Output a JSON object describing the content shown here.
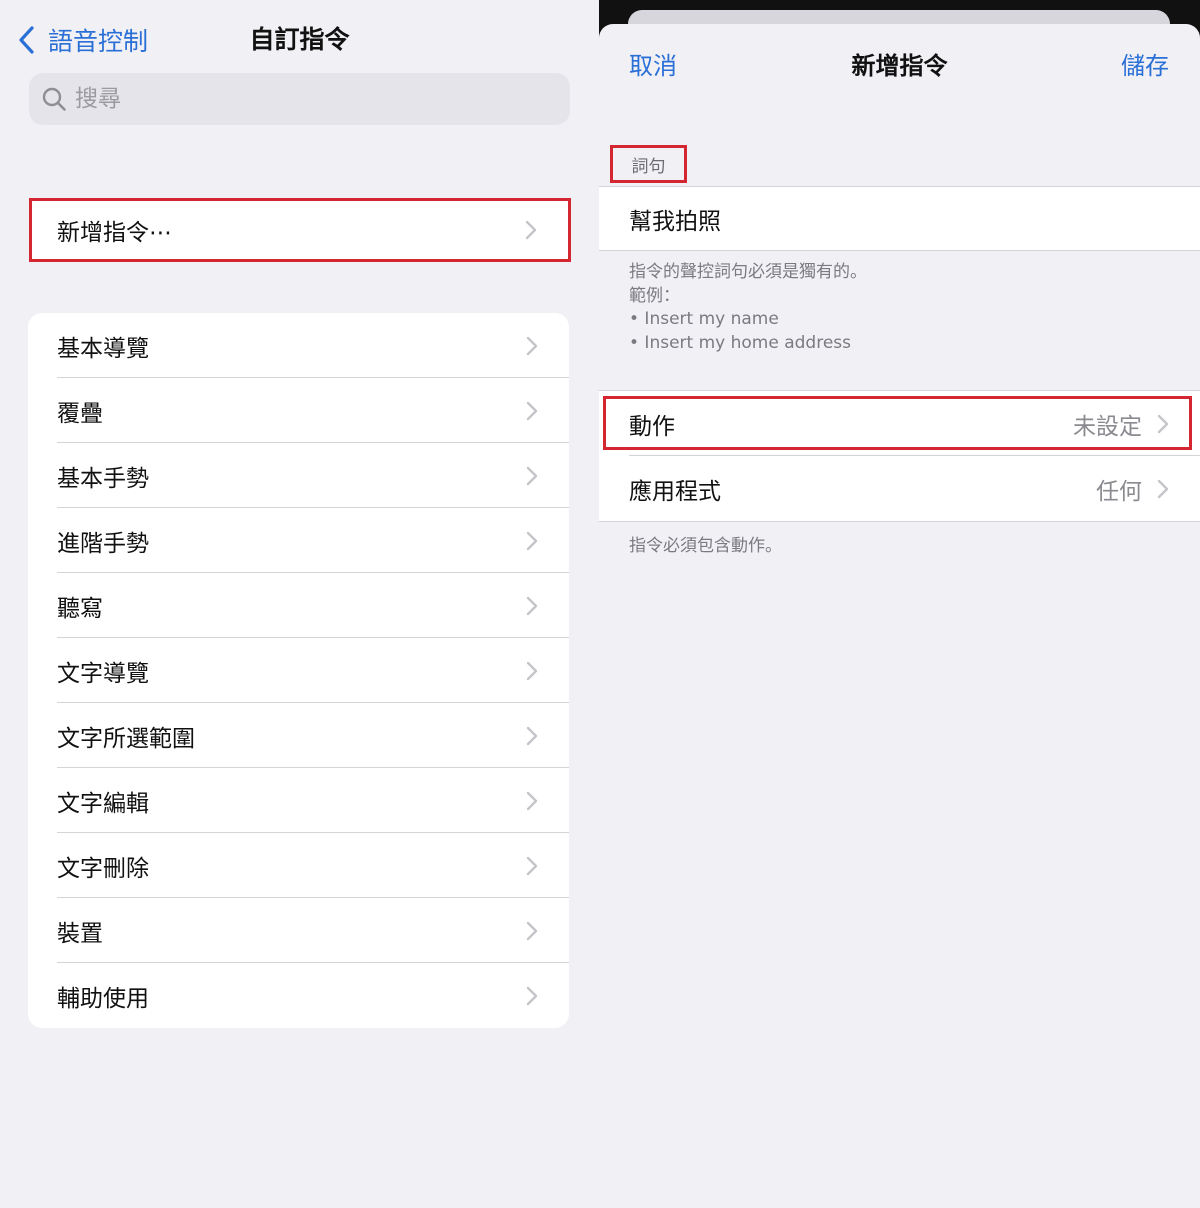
{
  "left": {
    "back_label": "語音控制",
    "title": "自訂指令",
    "search_placeholder": "搜尋",
    "add_label": "新增指令⋯",
    "items": [
      {
        "label": "基本導覽"
      },
      {
        "label": "覆疊"
      },
      {
        "label": "基本手勢"
      },
      {
        "label": "進階手勢"
      },
      {
        "label": "聽寫"
      },
      {
        "label": "文字導覽"
      },
      {
        "label": "文字所選範圍"
      },
      {
        "label": "文字編輯"
      },
      {
        "label": "文字刪除"
      },
      {
        "label": "裝置"
      },
      {
        "label": "輔助使用"
      }
    ]
  },
  "right": {
    "cancel_label": "取消",
    "title": "新增指令",
    "save_label": "儲存",
    "phrase_section_label": "詞句",
    "phrase_value": "幫我拍照",
    "phrase_note": [
      "指令的聲控詞句必須是獨有的。",
      "範例：",
      "• Insert my name",
      "• Insert my home address"
    ],
    "action_label": "動作",
    "action_value": "未設定",
    "app_label": "應用程式",
    "app_value": "任何",
    "action_note": "指令必須包含動作。"
  },
  "colors": {
    "accent": "#2a6fd6",
    "highlight_border": "#d32630",
    "background": "#f0f0f5"
  },
  "icons": [
    "chevron-left-icon",
    "search-icon",
    "chevron-right-icon"
  ]
}
